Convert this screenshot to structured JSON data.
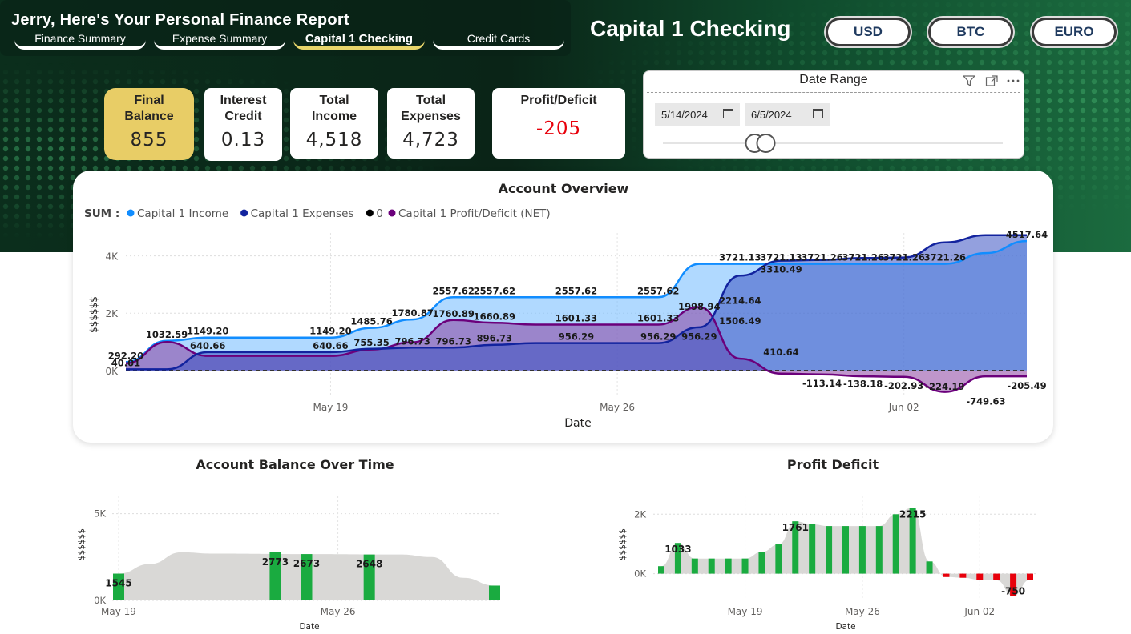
{
  "header": {
    "report_title": "Jerry, Here's Your Personal Finance Report",
    "tabs": [
      {
        "label": "Finance Summary",
        "active": false
      },
      {
        "label": "Expense Summary",
        "active": false
      },
      {
        "label": "Capital 1 Checking",
        "active": true
      },
      {
        "label": "Credit Cards",
        "active": false
      }
    ],
    "account_title": "Capital 1 Checking",
    "currency_buttons": [
      "USD",
      "BTC",
      "EURO"
    ]
  },
  "kpis": [
    {
      "label_line1": "Final",
      "label_line2": "Balance",
      "value": "855"
    },
    {
      "label_line1": "Interest",
      "label_line2": "Credit",
      "value": "0.13"
    },
    {
      "label_line1": "Total",
      "label_line2": "Income",
      "value": "4,518"
    },
    {
      "label_line1": "Total",
      "label_line2": "Expenses",
      "value": "4,723"
    },
    {
      "label_line1": "Profit/Deficit",
      "label_line2": "",
      "value": "-205"
    }
  ],
  "date_range": {
    "title": "Date Range",
    "start": "5/14/2024",
    "end": "6/5/2024",
    "slider_position": 0.27
  },
  "colors": {
    "income": "#118DFF",
    "expenses": "#12239E",
    "zero": "#000000",
    "net": "#6B007B",
    "positive_bar": "#1AAB40",
    "negative_bar": "#E8000B",
    "deficit_value": "#E8000B",
    "kpi_highlight": "#E8CD66"
  },
  "chart_data": [
    {
      "type": "area",
      "title": "Account Overview",
      "xlabel": "Date",
      "ylabel": "$$$$$$",
      "legend_prefix": "SUM :",
      "legend_placement": "top-left",
      "ylim": [
        -900,
        4800
      ],
      "yticks": [
        0,
        2000,
        4000
      ],
      "ytick_labels": [
        "0K",
        "2K",
        "4K"
      ],
      "xtick_labels": [
        {
          "date": "2024-05-19",
          "label": "May 19"
        },
        {
          "date": "2024-05-26",
          "label": "May 26"
        },
        {
          "date": "2024-06-02",
          "label": "Jun 02"
        }
      ],
      "x": [
        "2024-05-14",
        "2024-05-15",
        "2024-05-16",
        "2024-05-17",
        "2024-05-18",
        "2024-05-19",
        "2024-05-20",
        "2024-05-21",
        "2024-05-22",
        "2024-05-23",
        "2024-05-24",
        "2024-05-25",
        "2024-05-26",
        "2024-05-27",
        "2024-05-28",
        "2024-05-29",
        "2024-05-30",
        "2024-05-31",
        "2024-06-01",
        "2024-06-02",
        "2024-06-03",
        "2024-06-04",
        "2024-06-05"
      ],
      "series": [
        {
          "name": "Capital 1 Income",
          "values": [
            292.2,
            1032.59,
            1149.2,
            1149.2,
            1149.2,
            1149.2,
            1485.76,
            1780.87,
            2557.62,
            2557.62,
            2557.62,
            2557.62,
            2557.62,
            2557.62,
            3721.13,
            3721.13,
            3721.26,
            3721.26,
            3721.26,
            3721.26,
            3721.26,
            4100,
            4517.64
          ]
        },
        {
          "name": "Capital 1 Expenses",
          "values": [
            40.01,
            40.01,
            640.66,
            640.66,
            640.66,
            640.66,
            755.35,
            796.73,
            796.73,
            896.73,
            956.29,
            956.29,
            956.29,
            956.29,
            1506.49,
            3310.49,
            3834.4,
            3859.44,
            3924.19,
            3945.45,
            4470.89,
            4723.13,
            4723.13
          ]
        },
        {
          "name": "0",
          "values": [
            0,
            0,
            0,
            0,
            0,
            0,
            0,
            0,
            0,
            0,
            0,
            0,
            0,
            0,
            0,
            0,
            0,
            0,
            0,
            0,
            0,
            0,
            0
          ]
        },
        {
          "name": "Capital 1 Profit/Deficit (NET)",
          "values": [
            252.19,
            992.58,
            508.54,
            508.54,
            508.54,
            508.54,
            730.41,
            984.14,
            1760.89,
            1660.89,
            1601.33,
            1601.33,
            1601.33,
            1601.33,
            2214.64,
            410.64,
            -113.14,
            -138.18,
            -202.93,
            -224.19,
            -749.63,
            -205.49,
            -205.49
          ]
        }
      ],
      "data_labels": [
        {
          "date": "2024-05-14",
          "value": 292.2,
          "text": "292.20"
        },
        {
          "date": "2024-05-14",
          "value": 40.01,
          "text": "40.01"
        },
        {
          "date": "2024-05-15",
          "value": 1032.59,
          "text": "1032.59"
        },
        {
          "date": "2024-05-16",
          "value": 1149.2,
          "text": "1149.20"
        },
        {
          "date": "2024-05-16",
          "value": 640.66,
          "text": "640.66"
        },
        {
          "date": "2024-05-19",
          "value": 1149.2,
          "text": "1149.20"
        },
        {
          "date": "2024-05-19",
          "value": 640.66,
          "text": "640.66"
        },
        {
          "date": "2024-05-20",
          "value": 1485.76,
          "text": "1485.76"
        },
        {
          "date": "2024-05-20",
          "value": 755.35,
          "text": "755.35"
        },
        {
          "date": "2024-05-21",
          "value": 1780.87,
          "text": "1780.87"
        },
        {
          "date": "2024-05-21",
          "value": 796.73,
          "text": "796.73"
        },
        {
          "date": "2024-05-22",
          "value": 2557.62,
          "text": "2557.62"
        },
        {
          "date": "2024-05-22",
          "value": 1760.89,
          "text": "1760.89"
        },
        {
          "date": "2024-05-22",
          "value": 796.73,
          "text": "796.73"
        },
        {
          "date": "2024-05-23",
          "value": 2557.62,
          "text": "2557.62"
        },
        {
          "date": "2024-05-23",
          "value": 1660.89,
          "text": "1660.89"
        },
        {
          "date": "2024-05-23",
          "value": 896.73,
          "text": "896.73"
        },
        {
          "date": "2024-05-25",
          "value": 2557.62,
          "text": "2557.62"
        },
        {
          "date": "2024-05-25",
          "value": 1601.33,
          "text": "1601.33"
        },
        {
          "date": "2024-05-25",
          "value": 956.29,
          "text": "956.29"
        },
        {
          "date": "2024-05-27",
          "value": 2557.62,
          "text": "2557.62"
        },
        {
          "date": "2024-05-27",
          "value": 1601.33,
          "text": "1601.33"
        },
        {
          "date": "2024-05-27",
          "value": 956.29,
          "text": "956.29"
        },
        {
          "date": "2024-05-28",
          "value": 1998.94,
          "text": "1998.94"
        },
        {
          "date": "2024-05-28",
          "value": 956.29,
          "text": "956.29"
        },
        {
          "date": "2024-05-29",
          "value": 3721.13,
          "text": "3721.13"
        },
        {
          "date": "2024-05-29",
          "value": 2214.64,
          "text": "2214.64"
        },
        {
          "date": "2024-05-29",
          "value": 1506.49,
          "text": "1506.49"
        },
        {
          "date": "2024-05-30",
          "value": 3721.13,
          "text": "3721.13"
        },
        {
          "date": "2024-05-30",
          "value": 3310.49,
          "text": "3310.49"
        },
        {
          "date": "2024-05-30",
          "value": 410.64,
          "text": "410.64"
        },
        {
          "date": "2024-05-31",
          "value": 3721.26,
          "text": "3721.26"
        },
        {
          "date": "2024-05-31",
          "value": -113.14,
          "text": "-113.14"
        },
        {
          "date": "2024-06-01",
          "value": 3721.26,
          "text": "3721.26"
        },
        {
          "date": "2024-06-01",
          "value": -138.18,
          "text": "-138.18"
        },
        {
          "date": "2024-06-02",
          "value": 3721.26,
          "text": "3721.26"
        },
        {
          "date": "2024-06-02",
          "value": -202.93,
          "text": "-202.93"
        },
        {
          "date": "2024-06-03",
          "value": 3721.26,
          "text": "3721.26"
        },
        {
          "date": "2024-06-03",
          "value": -224.19,
          "text": "-224.19"
        },
        {
          "date": "2024-06-04",
          "value": -749.63,
          "text": "-749.63"
        },
        {
          "date": "2024-06-05",
          "value": 4517.64,
          "text": "4517.64"
        },
        {
          "date": "2024-06-05",
          "value": -205.49,
          "text": "-205.49"
        }
      ]
    },
    {
      "type": "bar",
      "title": "Account Balance Over Time",
      "xlabel": "Date",
      "ylabel": "$$$$$$",
      "ylim": [
        0,
        6000
      ],
      "yticks": [
        0,
        5000
      ],
      "ytick_labels": [
        "0K",
        "5K"
      ],
      "xtick_labels": [
        {
          "date": "2024-05-19",
          "label": "May 19"
        },
        {
          "date": "2024-05-26",
          "label": "May 26"
        }
      ],
      "bars": [
        {
          "date": "2024-05-19",
          "value": 1545
        },
        {
          "date": "2024-05-24",
          "value": 2773
        },
        {
          "date": "2024-05-25",
          "value": 2673
        },
        {
          "date": "2024-05-27",
          "value": 2648
        },
        {
          "date": "2024-05-31",
          "value": 855
        }
      ],
      "band": [
        {
          "date": "2024-05-19",
          "value": 1545
        },
        {
          "date": "2024-05-20",
          "value": 2100
        },
        {
          "date": "2024-05-21",
          "value": 2773
        },
        {
          "date": "2024-05-22",
          "value": 2700
        },
        {
          "date": "2024-05-25",
          "value": 2673
        },
        {
          "date": "2024-05-28",
          "value": 2648
        },
        {
          "date": "2024-05-29",
          "value": 2500
        },
        {
          "date": "2024-05-30",
          "value": 1300
        },
        {
          "date": "2024-05-31",
          "value": 855
        }
      ],
      "labels": [
        {
          "date": "2024-05-19",
          "value": 1545,
          "text": "1545"
        },
        {
          "date": "2024-05-24",
          "value": 2773,
          "text": "2773"
        },
        {
          "date": "2024-05-25",
          "value": 2673,
          "text": "2673"
        },
        {
          "date": "2024-05-27",
          "value": 2648,
          "text": "2648"
        }
      ]
    },
    {
      "type": "bar",
      "title": "Profit Deficit",
      "xlabel": "Date",
      "ylabel": "$$$$$$",
      "ylim": [
        -900,
        2600
      ],
      "yticks": [
        0,
        2000
      ],
      "ytick_labels": [
        "0K",
        "2K"
      ],
      "xtick_labels": [
        {
          "date": "2024-05-19",
          "label": "May 19"
        },
        {
          "date": "2024-05-26",
          "label": "May 26"
        },
        {
          "date": "2024-06-02",
          "label": "Jun 02"
        }
      ],
      "x": [
        "2024-05-14",
        "2024-05-15",
        "2024-05-16",
        "2024-05-17",
        "2024-05-18",
        "2024-05-19",
        "2024-05-20",
        "2024-05-21",
        "2024-05-22",
        "2024-05-23",
        "2024-05-24",
        "2024-05-25",
        "2024-05-26",
        "2024-05-27",
        "2024-05-28",
        "2024-05-29",
        "2024-05-30",
        "2024-05-31",
        "2024-06-01",
        "2024-06-02",
        "2024-06-03",
        "2024-06-04",
        "2024-06-05"
      ],
      "values": [
        252,
        1033,
        509,
        509,
        509,
        509,
        730,
        984,
        1761,
        1661,
        1601,
        1601,
        1601,
        1601,
        1999,
        2215,
        411,
        -113,
        -138,
        -203,
        -224,
        -750,
        -205
      ],
      "labels": [
        {
          "date": "2024-05-15",
          "value": 1033,
          "text": "1033"
        },
        {
          "date": "2024-05-22",
          "value": 1761,
          "text": "1761"
        },
        {
          "date": "2024-05-29",
          "value": 2215,
          "text": "2215"
        },
        {
          "date": "2024-06-04",
          "value": -750,
          "text": "-750"
        }
      ]
    }
  ]
}
